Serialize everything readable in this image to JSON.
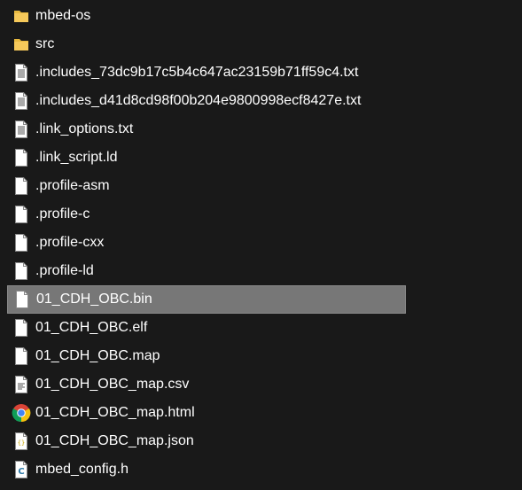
{
  "files": [
    {
      "name": "mbed-os",
      "icon": "folder-icon",
      "selected": false
    },
    {
      "name": "src",
      "icon": "folder-icon",
      "selected": false
    },
    {
      "name": ".includes_73dc9b17c5b4c647ac23159b71ff59c4.txt",
      "icon": "text-file-icon",
      "selected": false
    },
    {
      "name": ".includes_d41d8cd98f00b204e9800998ecf8427e.txt",
      "icon": "text-file-icon",
      "selected": false
    },
    {
      "name": ".link_options.txt",
      "icon": "text-file-icon",
      "selected": false
    },
    {
      "name": ".link_script.ld",
      "icon": "blank-file-icon",
      "selected": false
    },
    {
      "name": ".profile-asm",
      "icon": "blank-file-icon",
      "selected": false
    },
    {
      "name": ".profile-c",
      "icon": "blank-file-icon",
      "selected": false
    },
    {
      "name": ".profile-cxx",
      "icon": "blank-file-icon",
      "selected": false
    },
    {
      "name": ".profile-ld",
      "icon": "blank-file-icon",
      "selected": false
    },
    {
      "name": "01_CDH_OBC.bin",
      "icon": "blank-file-icon",
      "selected": true
    },
    {
      "name": "01_CDH_OBC.elf",
      "icon": "blank-file-icon",
      "selected": false
    },
    {
      "name": "01_CDH_OBC.map",
      "icon": "blank-file-icon",
      "selected": false
    },
    {
      "name": "01_CDH_OBC_map.csv",
      "icon": "csv-file-icon",
      "selected": false
    },
    {
      "name": "01_CDH_OBC_map.html",
      "icon": "chrome-icon",
      "selected": false
    },
    {
      "name": "01_CDH_OBC_map.json",
      "icon": "json-file-icon",
      "selected": false
    },
    {
      "name": "mbed_config.h",
      "icon": "c-header-file-icon",
      "selected": false
    }
  ],
  "colors": {
    "background": "#191919",
    "selection": "#777777",
    "folder": "#e8b93f",
    "text": "#ffffff"
  }
}
